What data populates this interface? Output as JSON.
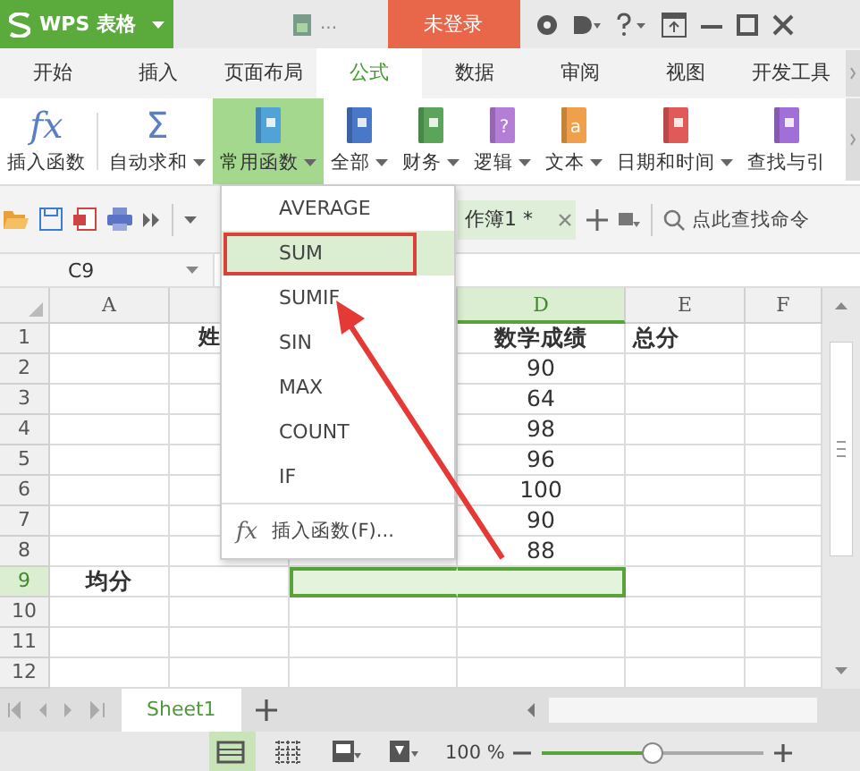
{
  "app": {
    "name": "WPS 表格",
    "file_more": "...",
    "login": "未登录"
  },
  "tabs": [
    {
      "label": "开始",
      "selected": false
    },
    {
      "label": "插入",
      "selected": false
    },
    {
      "label": "页面布局",
      "selected": false
    },
    {
      "label": "公式",
      "selected": true
    },
    {
      "label": "数据",
      "selected": false
    },
    {
      "label": "审阅",
      "selected": false
    },
    {
      "label": "视图",
      "selected": false
    },
    {
      "label": "开发工具",
      "selected": false
    }
  ],
  "ribbon": [
    {
      "label": "插入函数",
      "kind": "glyph",
      "glyph": "fx",
      "dropdown": false,
      "selected": false
    },
    {
      "label": "自动求和",
      "kind": "glyph",
      "glyph": "Σ",
      "dropdown": true,
      "selected": false
    },
    {
      "label": "常用函数",
      "kind": "book",
      "color": "#4fa3d9",
      "dropdown": true,
      "selected": true
    },
    {
      "label": "全部",
      "kind": "book",
      "color": "#4a78c8",
      "dropdown": true,
      "selected": false
    },
    {
      "label": "财务",
      "kind": "book",
      "color": "#5aa55a",
      "dropdown": true,
      "selected": false
    },
    {
      "label": "逻辑",
      "kind": "book",
      "color": "#b57ed6",
      "glyph": "?",
      "dropdown": true,
      "selected": false
    },
    {
      "label": "文本",
      "kind": "book",
      "color": "#f0a04a",
      "glyph": "a",
      "dropdown": true,
      "selected": false
    },
    {
      "label": "日期和时间",
      "kind": "book",
      "color": "#e05a5a",
      "dropdown": true,
      "selected": false
    },
    {
      "label": "查找与引",
      "kind": "book",
      "color": "#a070d8",
      "dropdown": false,
      "selected": false
    }
  ],
  "doc_tab": {
    "title": "作簿1 *"
  },
  "search": {
    "placeholder": "点此查找命令"
  },
  "name_box": {
    "value": "C9"
  },
  "menu": {
    "items": [
      {
        "label": "AVERAGE",
        "selected": false
      },
      {
        "label": "SUM",
        "selected": true
      },
      {
        "label": "SUMIF",
        "selected": false
      },
      {
        "label": "SIN",
        "selected": false
      },
      {
        "label": "MAX",
        "selected": false
      },
      {
        "label": "COUNT",
        "selected": false
      },
      {
        "label": "IF",
        "selected": false
      }
    ],
    "footer_glyph": "fx",
    "footer": "插入函数(F)..."
  },
  "columns": [
    {
      "label": "A",
      "selected": false
    },
    {
      "selected": false
    },
    {
      "selected": false
    },
    {
      "label": "D",
      "selected": true
    },
    {
      "label": "E",
      "selected": false
    },
    {
      "label": "F",
      "selected": false
    }
  ],
  "rows": [
    {
      "label": "1",
      "selected": false,
      "cells": [
        {
          "selected": false
        },
        {
          "text": "姓",
          "kind": "partial",
          "selected": false
        },
        {
          "selected": false
        },
        {
          "text": "数学成绩",
          "kind": "heading",
          "selected": false
        },
        {
          "text": "总分",
          "kind": "heading-left",
          "selected": false
        },
        {
          "selected": false
        }
      ]
    },
    {
      "label": "2",
      "selected": false,
      "cells": [
        {
          "selected": false
        },
        {
          "selected": false
        },
        {
          "selected": false
        },
        {
          "text": "90",
          "kind": "number",
          "selected": false
        },
        {
          "selected": false
        },
        {
          "selected": false
        }
      ]
    },
    {
      "label": "3",
      "selected": false,
      "cells": [
        {
          "selected": false
        },
        {
          "selected": false
        },
        {
          "selected": false
        },
        {
          "text": "64",
          "kind": "number",
          "selected": false
        },
        {
          "selected": false
        },
        {
          "selected": false
        }
      ]
    },
    {
      "label": "4",
      "selected": false,
      "cells": [
        {
          "selected": false
        },
        {
          "selected": false
        },
        {
          "selected": false
        },
        {
          "text": "98",
          "kind": "number",
          "selected": false
        },
        {
          "selected": false
        },
        {
          "selected": false
        }
      ]
    },
    {
      "label": "5",
      "selected": false,
      "cells": [
        {
          "selected": false
        },
        {
          "selected": false
        },
        {
          "selected": false
        },
        {
          "text": "96",
          "kind": "number",
          "selected": false
        },
        {
          "selected": false
        },
        {
          "selected": false
        }
      ]
    },
    {
      "label": "6",
      "selected": false,
      "cells": [
        {
          "selected": false
        },
        {
          "selected": false
        },
        {
          "selected": false
        },
        {
          "text": "100",
          "kind": "number",
          "selected": false
        },
        {
          "selected": false
        },
        {
          "selected": false
        }
      ]
    },
    {
      "label": "7",
      "selected": false,
      "cells": [
        {
          "selected": false
        },
        {
          "selected": false
        },
        {
          "selected": false
        },
        {
          "text": "90",
          "kind": "number",
          "selected": false
        },
        {
          "selected": false
        },
        {
          "selected": false
        }
      ]
    },
    {
      "label": "8",
      "selected": false,
      "cells": [
        {
          "selected": false
        },
        {
          "selected": false
        },
        {
          "selected": false
        },
        {
          "text": "88",
          "kind": "number",
          "selected": false
        },
        {
          "selected": false
        },
        {
          "selected": false
        }
      ]
    },
    {
      "label": "9",
      "selected": true,
      "cells": [
        {
          "text": "均分",
          "kind": "heading",
          "selected": false
        },
        {
          "selected": false
        },
        {
          "selected": true
        },
        {
          "selected": true
        },
        {
          "selected": false
        },
        {
          "selected": false
        }
      ]
    },
    {
      "label": "10",
      "selected": false,
      "cells": [
        {
          "selected": false
        },
        {
          "selected": false
        },
        {
          "selected": false
        },
        {
          "selected": false
        },
        {
          "selected": false
        },
        {
          "selected": false
        }
      ]
    },
    {
      "label": "11",
      "selected": false,
      "cells": [
        {
          "selected": false
        },
        {
          "selected": false
        },
        {
          "selected": false
        },
        {
          "selected": false
        },
        {
          "selected": false
        },
        {
          "selected": false
        }
      ]
    },
    {
      "label": "12",
      "selected": false,
      "cells": [
        {
          "selected": false
        },
        {
          "selected": false
        },
        {
          "selected": false
        },
        {
          "selected": false
        },
        {
          "selected": false
        },
        {
          "selected": false
        }
      ]
    }
  ],
  "sheets": [
    {
      "label": "Sheet1",
      "selected": true
    }
  ],
  "views": [
    {
      "kind": "normal",
      "selected": true
    },
    {
      "kind": "page-break",
      "selected": false
    },
    {
      "kind": "layout",
      "selected": false
    },
    {
      "kind": "reading",
      "selected": false
    }
  ],
  "zoom": {
    "reading": "100 %",
    "level": 0.5
  }
}
